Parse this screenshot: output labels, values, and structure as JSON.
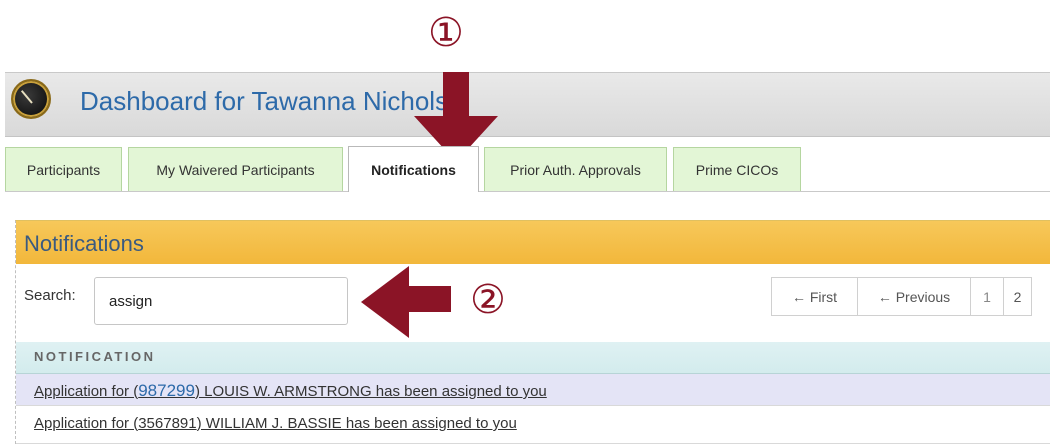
{
  "markers": {
    "one": "①",
    "two": "②"
  },
  "header": {
    "title": "Dashboard for Tawanna Nichols"
  },
  "tabs": [
    {
      "label": "Participants"
    },
    {
      "label": "My Waivered Participants"
    },
    {
      "label": "Notifications"
    },
    {
      "label": "Prior Auth. Approvals"
    },
    {
      "label": "Prime CICOs"
    }
  ],
  "active_tab": "Notifications",
  "panel": {
    "title": "Notifications",
    "search_label": "Search:",
    "search_value": "assign",
    "pager": [
      "← First",
      "← Previous",
      "1",
      "2"
    ],
    "column_header": "NOTIFICATION",
    "rows": [
      {
        "prefix": "Application for (",
        "id": "987299",
        "suffix": ") LOUIS W. ARMSTRONG has been assigned to you"
      },
      {
        "prefix": "Application for (",
        "id": "3567891",
        "suffix": ") WILLIAM J. BASSIE   has been assigned to you"
      }
    ]
  },
  "colors": {
    "accent": "#8b1426",
    "header_bar": "#f2b73b",
    "tab_green": "#e3f6d6",
    "title_blue": "#2d6aa9"
  }
}
